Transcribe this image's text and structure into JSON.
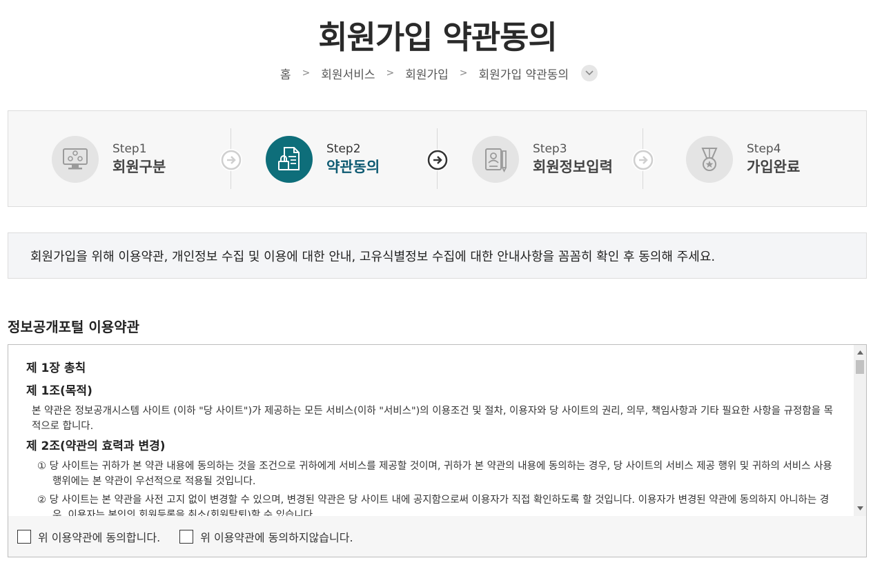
{
  "header": {
    "title": "회원가입 약관동의"
  },
  "breadcrumb": {
    "items": [
      "홈",
      "회원서비스",
      "회원가입",
      "회원가입 약관동의"
    ]
  },
  "steps": [
    {
      "num": "Step1",
      "label": "회원구분",
      "icon": "computer-users-icon",
      "active": false
    },
    {
      "num": "Step2",
      "label": "약관동의",
      "icon": "document-lock-icon",
      "active": true
    },
    {
      "num": "Step3",
      "label": "회원정보입력",
      "icon": "profile-card-pen-icon",
      "active": false
    },
    {
      "num": "Step4",
      "label": "가입완료",
      "icon": "medal-icon",
      "active": false
    }
  ],
  "notice": {
    "text": "회원가입을 위해 이용약관, 개인정보 수집 및 이용에 대한 안내, 고유식별정보 수집에 대한 안내사항을 꼼꼼히 확인 후 동의해 주세요."
  },
  "terms": {
    "title": "정보공개포털 이용약관",
    "chapter": "제 1장 총칙",
    "article1_title": "제 1조(목적)",
    "article1_text": "본 약관은 정보공개시스템 사이트 (이하 \"당 사이트\")가 제공하는 모든 서비스(이하 \"서비스\")의 이용조건 및 절차, 이용자와 당 사이트의 권리, 의무, 책임사항과 기타 필요한 사항을 규정함을 목적으로 합니다.",
    "article2_title": "제 2조(약관의 효력과 변경)",
    "article2_item1": "① 당 사이트는 귀하가 본 약관 내용에 동의하는 것을 조건으로 귀하에게 서비스를 제공할 것이며, 귀하가 본 약관의 내용에 동의하는 경우, 당 사이트의 서비스 제공 행위 및 귀하의 서비스 사용 행위에는 본 약관이 우선적으로 적용될 것입니다.",
    "article2_item2": "② 당 사이트는 본 약관을 사전 고지 없이 변경할 수 있으며, 변경된 약관은 당 사이트 내에 공지함으로써 이용자가 직접 확인하도록 할 것입니다. 이용자가 변경된 약관에 동의하지 아니하는 경우, 이용자는 본인의 회원등록을 취소(회원탈퇴)할 수 있습니다."
  },
  "agree": {
    "agree_label": "위 이용약관에 동의합니다.",
    "disagree_label": "위 이용약관에 동의하지않습니다."
  },
  "colors": {
    "accent": "#0e6e7a",
    "active_text": "#0e5a72"
  }
}
